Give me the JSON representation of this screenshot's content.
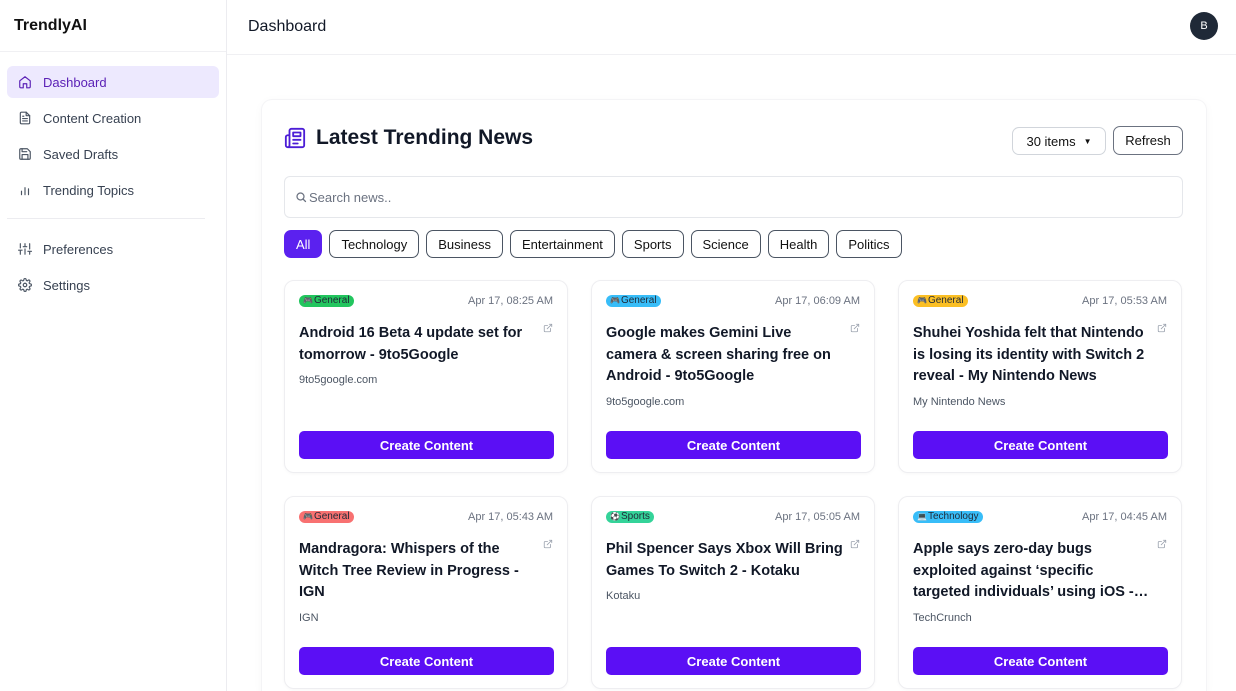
{
  "app": {
    "brand": "TrendlyAI"
  },
  "sidebar": {
    "items": [
      {
        "label": "Dashboard",
        "icon": "home-icon",
        "active": true
      },
      {
        "label": "Content Creation",
        "icon": "file-text-icon"
      },
      {
        "label": "Saved Drafts",
        "icon": "save-icon"
      },
      {
        "label": "Trending Topics",
        "icon": "bar-chart-icon"
      }
    ],
    "secondary": [
      {
        "label": "Preferences",
        "icon": "sliders-icon"
      },
      {
        "label": "Settings",
        "icon": "gear-icon"
      }
    ]
  },
  "header": {
    "title": "Dashboard",
    "avatar_initial": "B"
  },
  "panel": {
    "title": "Latest Trending News",
    "icon": "newspaper-icon",
    "items_select": "30 items",
    "refresh_label": "Refresh",
    "search_placeholder": "Search news..",
    "filters": [
      "All",
      "Technology",
      "Business",
      "Entertainment",
      "Sports",
      "Science",
      "Health",
      "Politics"
    ],
    "active_filter": "All"
  },
  "cards": [
    {
      "category": "General",
      "category_icon": "game-controller-icon",
      "badge_color": "#22c55e",
      "date": "Apr 17, 08:25 AM",
      "title": "Android 16 Beta 4 update set for tomorrow - 9to5Google",
      "source": "9to5google.com",
      "button": "Create Content"
    },
    {
      "category": "General",
      "category_icon": "game-controller-icon",
      "badge_color": "#38bdf8",
      "date": "Apr 17, 06:09 AM",
      "title": "Google makes Gemini Live camera & screen sharing free on Android - 9to5Google",
      "source": "9to5google.com",
      "button": "Create Content"
    },
    {
      "category": "General",
      "category_icon": "game-controller-icon",
      "badge_color": "#fbbf24",
      "date": "Apr 17, 05:53 AM",
      "title": "Shuhei Yoshida felt that Nintendo is losing its identity with Switch 2 reveal - My Nintendo News",
      "source": "My Nintendo News",
      "button": "Create Content"
    },
    {
      "category": "General",
      "category_icon": "game-controller-icon",
      "badge_color": "#f87171",
      "date": "Apr 17, 05:43 AM",
      "title": "Mandragora: Whispers of the Witch Tree Review in Progress - IGN",
      "source": "IGN",
      "button": "Create Content"
    },
    {
      "category": "Sports",
      "category_icon": "soccer-ball-icon",
      "badge_color": "#34d399",
      "date": "Apr 17, 05:05 AM",
      "title": "Phil Spencer Says Xbox Will Bring Games To Switch 2 - Kotaku",
      "source": "Kotaku",
      "button": "Create Content"
    },
    {
      "category": "Technology",
      "category_icon": "laptop-icon",
      "badge_color": "#38bdf8",
      "date": "Apr 17, 04:45 AM",
      "title": "Apple says zero-day bugs exploited against ‘specific targeted individuals’ using iOS -…",
      "source": "TechCrunch",
      "button": "Create Content"
    }
  ]
}
